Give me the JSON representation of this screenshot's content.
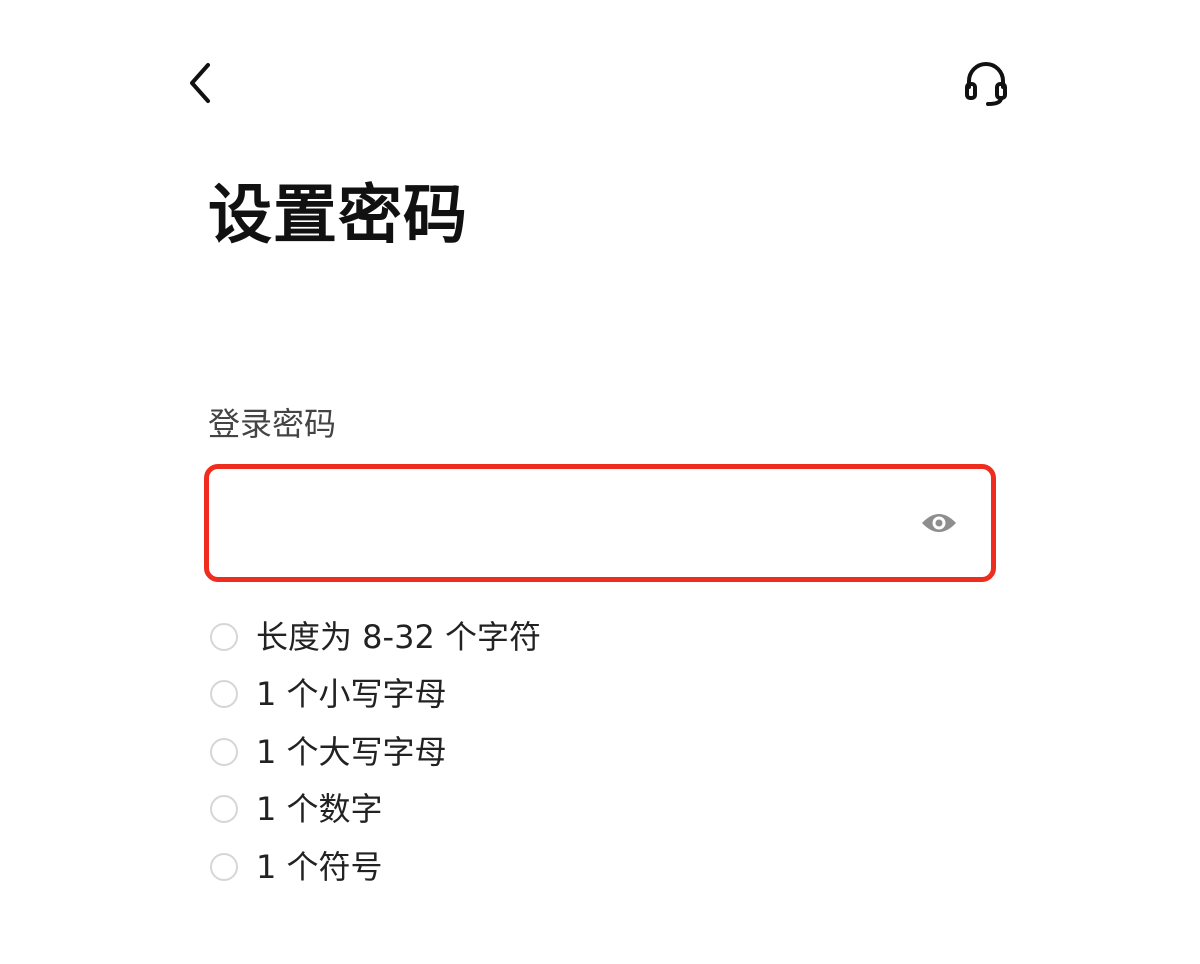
{
  "header": {
    "back_icon": "chevron-left-icon",
    "support_icon": "headset-icon"
  },
  "page": {
    "title": "设置密码"
  },
  "password_field": {
    "label": "登录密码",
    "value": "",
    "placeholder": "",
    "toggle_icon": "eye-icon",
    "error_color": "#ef2d1e"
  },
  "rules": [
    {
      "text": "长度为 8-32 个字符",
      "met": false
    },
    {
      "text": "1 个小写字母",
      "met": false
    },
    {
      "text": "1 个大写字母",
      "met": false
    },
    {
      "text": "1 个数字",
      "met": false
    },
    {
      "text": "1 个符号",
      "met": false
    }
  ]
}
